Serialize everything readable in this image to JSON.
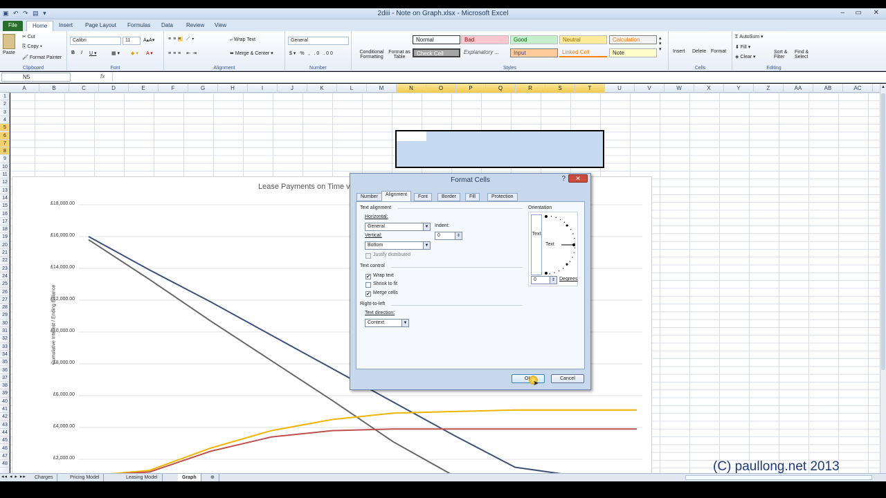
{
  "window": {
    "title": "2diii - Note on Graph.xlsx - Microsoft Excel"
  },
  "tabs": [
    "File",
    "Home",
    "Insert",
    "Page Layout",
    "Formulas",
    "Data",
    "Review",
    "View"
  ],
  "ribbon": {
    "clipboard": {
      "paste": "Paste",
      "cut": "Cut",
      "copy": "Copy",
      "format_painter": "Format Painter",
      "label": "Clipboard"
    },
    "font": {
      "name": "Calibri",
      "size": "11",
      "label": "Font"
    },
    "alignment": {
      "wrap_text": "Wrap Text",
      "merge_center": "Merge & Center",
      "label": "Alignment"
    },
    "number": {
      "format": "General",
      "label": "Number"
    },
    "styles": {
      "conditional": "Conditional Formatting",
      "format_table": "Format as Table",
      "cells": [
        {
          "text": "Normal",
          "bg": "#ffffff",
          "fg": "#000000"
        },
        {
          "text": "Bad",
          "bg": "#ffc7ce",
          "fg": "#9c0006"
        },
        {
          "text": "Good",
          "bg": "#c6efce",
          "fg": "#006100"
        },
        {
          "text": "Neutral",
          "bg": "#ffeb9c",
          "fg": "#9c6500"
        },
        {
          "text": "Calculation",
          "bg": "#f2f2f2",
          "fg": "#fa7d00"
        },
        {
          "text": "Check Cell",
          "bg": "#a5a5a5",
          "fg": "#ffffff"
        },
        {
          "text": "Explanatory ...",
          "bg": "#ffffff",
          "fg": "#7f7f7f"
        },
        {
          "text": "Input",
          "bg": "#ffcc99",
          "fg": "#3f3f76"
        },
        {
          "text": "Linked Cell",
          "bg": "#ffffff",
          "fg": "#fa7d00"
        },
        {
          "text": "Note",
          "bg": "#ffffcc",
          "fg": "#000000"
        }
      ],
      "label": "Styles"
    },
    "cells": {
      "insert": "Insert",
      "delete": "Delete",
      "format": "Format",
      "label": "Cells"
    },
    "editing": {
      "autosum": "AutoSum",
      "fill": "Fill",
      "clear": "Clear",
      "sort_filter": "Sort & Filter",
      "find_select": "Find & Select",
      "label": "Editing"
    }
  },
  "formula_bar": {
    "name_box": "N5",
    "fx": "fx",
    "formula": ""
  },
  "columns": [
    "A",
    "B",
    "C",
    "D",
    "E",
    "F",
    "G",
    "H",
    "I",
    "J",
    "K",
    "L",
    "M",
    "N",
    "O",
    "P",
    "Q",
    "R",
    "S",
    "T",
    "U",
    "V",
    "W",
    "X",
    "Y",
    "Z",
    "AA",
    "AB",
    "AC"
  ],
  "selected_columns": [
    "N",
    "O",
    "P",
    "Q",
    "R",
    "S",
    "T"
  ],
  "rows": [
    "1",
    "2",
    "3",
    "4",
    "5",
    "6",
    "7",
    "8",
    "9",
    "10",
    "11",
    "12",
    "13",
    "14",
    "15",
    "16",
    "17",
    "18",
    "19",
    "20",
    "21",
    "22",
    "23",
    "24",
    "25",
    "26",
    "27",
    "28",
    "29",
    "30",
    "31",
    "32",
    "33",
    "34",
    "35",
    "36",
    "37",
    "38",
    "39",
    "40",
    "41",
    "42",
    "43",
    "44",
    "45",
    "46",
    "47",
    "48"
  ],
  "selected_rows": [
    "5",
    "6",
    "7",
    "8"
  ],
  "chart": {
    "title": "Lease Payments on Time v",
    "ylabel": "Cumulative Interest / Ending Balance",
    "yticks": [
      "£18,000.00",
      "£16,000.00",
      "£14,000.00",
      "£12,000.00",
      "£10,000.00",
      "£8,000.00",
      "£6,000.00",
      "£4,000.00",
      "£2,000.00"
    ]
  },
  "chart_data": {
    "type": "line",
    "title": "Lease Payments on Time v",
    "ylabel": "Cumulative Interest / Ending Balance",
    "ylim": [
      0,
      18000
    ],
    "series": [
      {
        "color": "#3c5079",
        "points": [
          [
            0,
            16000
          ],
          [
            1,
            13900
          ],
          [
            2,
            11900
          ],
          [
            3,
            9800
          ],
          [
            4,
            7700
          ],
          [
            5,
            5600
          ],
          [
            6,
            3500
          ],
          [
            7,
            1500
          ],
          [
            8,
            0
          ]
        ]
      },
      {
        "color": "#666666",
        "points": [
          [
            0,
            15800
          ],
          [
            1,
            13300
          ],
          [
            2,
            10700
          ],
          [
            3,
            8200
          ],
          [
            4,
            5700
          ],
          [
            5,
            3100
          ],
          [
            6,
            600
          ]
        ]
      },
      {
        "color": "#f0b400",
        "points": [
          [
            0,
            0
          ],
          [
            1,
            1300
          ],
          [
            2,
            2700
          ],
          [
            3,
            3800
          ],
          [
            4,
            4500
          ],
          [
            5,
            4900
          ],
          [
            6,
            5000
          ],
          [
            7,
            5100
          ],
          [
            8,
            5100
          ],
          [
            9,
            5100
          ]
        ]
      },
      {
        "color": "#c0504d",
        "points": [
          [
            0,
            0
          ],
          [
            1,
            1200
          ],
          [
            2,
            2500
          ],
          [
            3,
            3400
          ],
          [
            4,
            3800
          ],
          [
            5,
            3900
          ],
          [
            6,
            3900
          ],
          [
            7,
            3900
          ],
          [
            8,
            3900
          ],
          [
            9,
            3900
          ]
        ]
      }
    ]
  },
  "dialog": {
    "title": "Format Cells",
    "help": "?",
    "tabs": [
      "Number",
      "Alignment",
      "Font",
      "Border",
      "Fill",
      "Protection"
    ],
    "active_tab": "Alignment",
    "text_alignment": "Text alignment",
    "horizontal_label": "Horizontal:",
    "horizontal_value": "General",
    "indent_label": "Indent:",
    "indent_value": "0",
    "vertical_label": "Vertical:",
    "vertical_value": "Bottom",
    "justify_distributed": "Justify distributed",
    "text_control": "Text control",
    "wrap_text": "Wrap text",
    "wrap_checked": true,
    "shrink_to_fit": "Shrink to fit",
    "shrink_checked": false,
    "merge_cells": "Merge cells",
    "merge_checked": true,
    "rtl": "Right-to-left",
    "text_direction_label": "Text direction:",
    "text_direction_value": "Context",
    "orientation": "Orientation",
    "orientation_vertical_text": "Text",
    "orientation_text": "Text",
    "degrees_value": "0",
    "degrees_label": "Degrees",
    "ok": "OK",
    "cancel": "Cancel"
  },
  "sheet_tabs": [
    "Charges",
    "Pricing Model",
    "Leasing Model",
    "Graph"
  ],
  "active_sheet": "Graph",
  "watermark": "(C) paullong.net 2013"
}
